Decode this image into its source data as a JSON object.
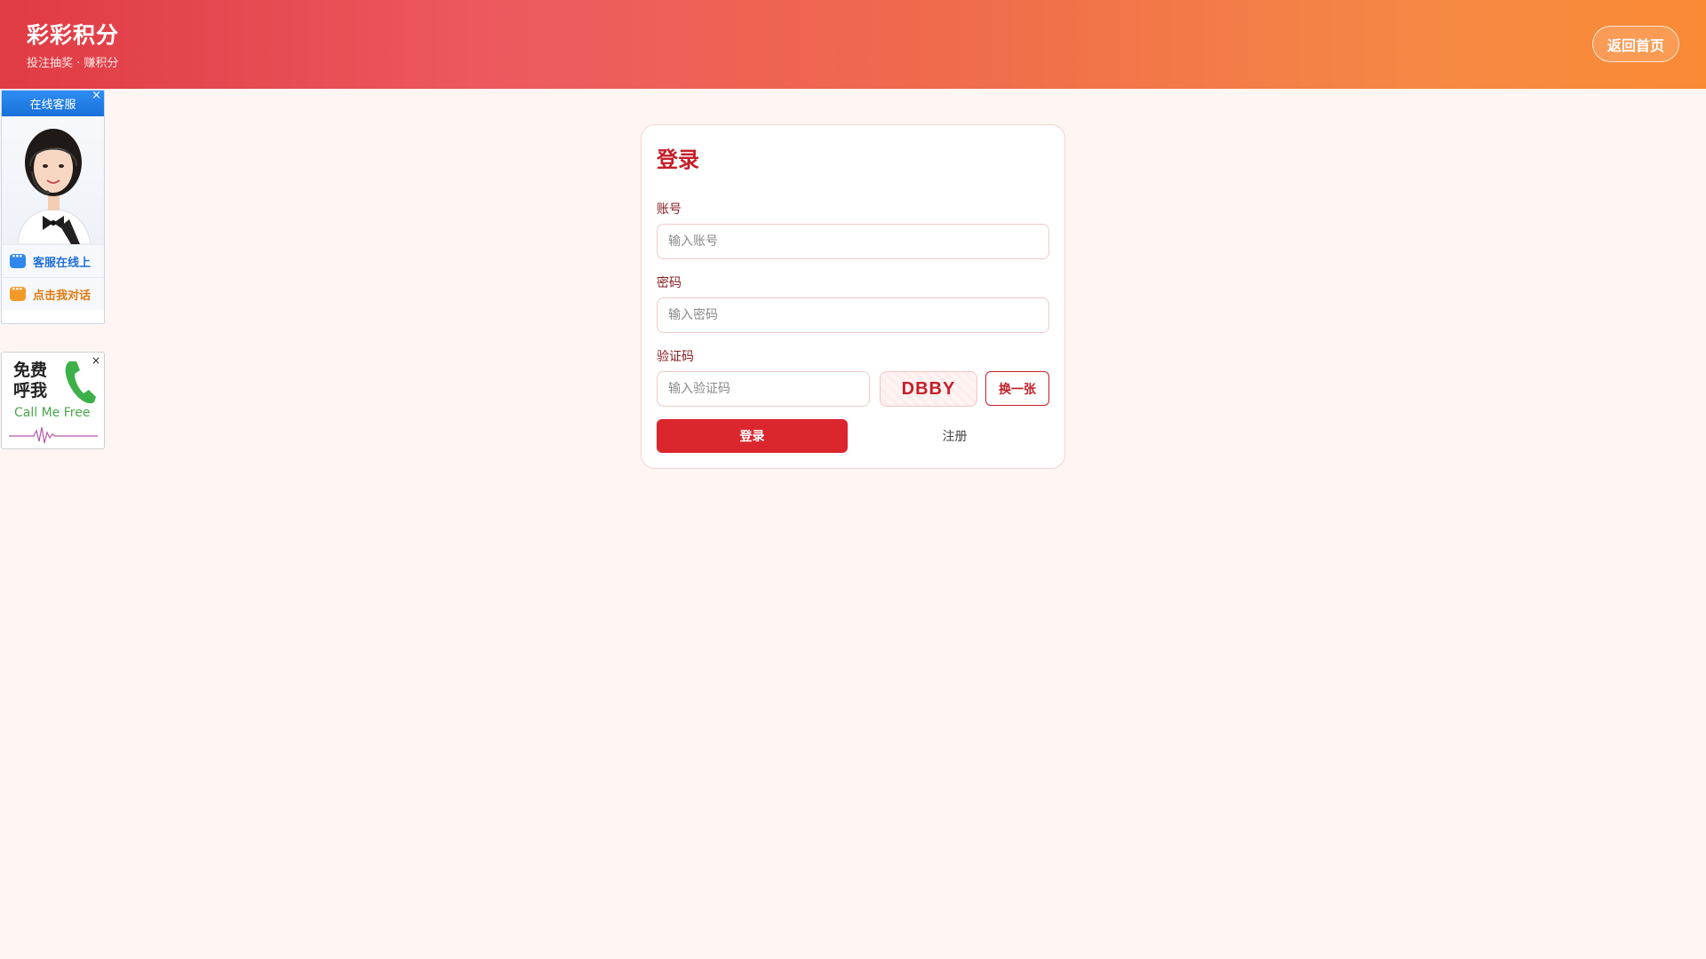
{
  "header": {
    "title": "彩彩积分",
    "subtitle": "投注抽奖 · 赚积分",
    "home_button": "返回首页"
  },
  "login": {
    "title": "登录",
    "account_label": "账号",
    "account_placeholder": "输入账号",
    "password_label": "密码",
    "password_placeholder": "输入密码",
    "captcha_label": "验证码",
    "captcha_placeholder": "输入验证码",
    "captcha_text": "DBBY",
    "refresh_label": "换一张",
    "submit_label": "登录",
    "register_label": "注册"
  },
  "service_widget": {
    "title": "在线客服",
    "close": "×",
    "rows": [
      {
        "label": "客服在线上",
        "color": "#1e6fd9",
        "icon_color": "#2f86ec",
        "icon": "chat-icon"
      },
      {
        "label": "点击我对话",
        "color": "#e17a0f",
        "icon_color": "#f29a28",
        "icon": "chat-icon"
      }
    ]
  },
  "callme_widget": {
    "title": "免费呼我",
    "subtitle": "Call Me  Free",
    "close": "×"
  },
  "colors": {
    "brand_red": "#dc262e",
    "accent_dark_red": "#c41e28",
    "page_bg": "#fff6f4"
  }
}
